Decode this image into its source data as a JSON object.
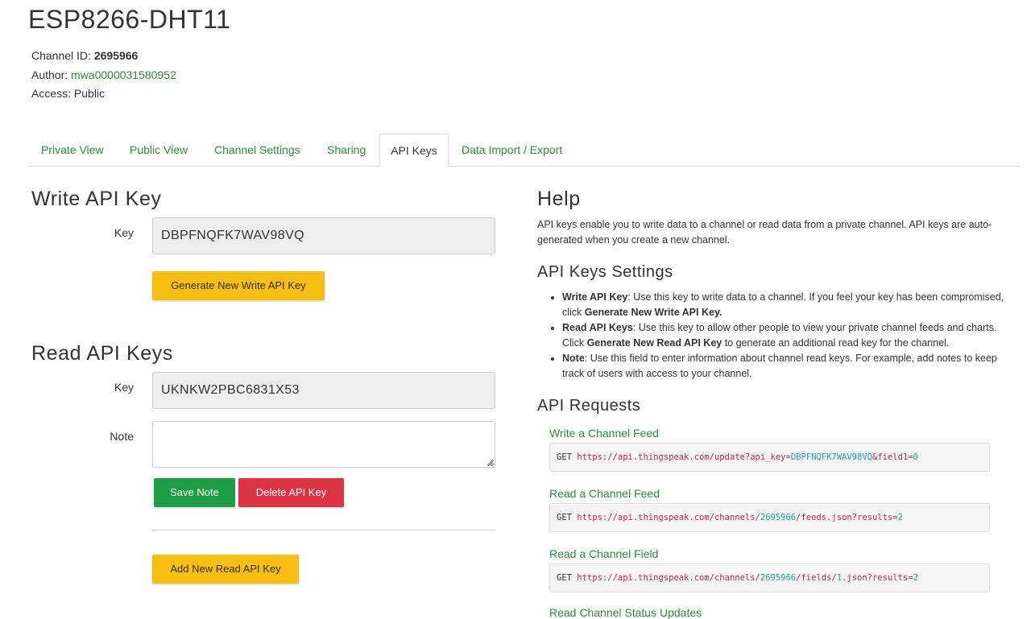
{
  "channel": {
    "title": "ESP8266-DHT11",
    "id_label": "Channel ID:",
    "id_value": "2695966",
    "author_label": "Author:",
    "author_value": "mwa0000031580952",
    "access_label": "Access:",
    "access_value": "Public"
  },
  "tabs": [
    {
      "label": "Private View"
    },
    {
      "label": "Public View"
    },
    {
      "label": "Channel Settings"
    },
    {
      "label": "Sharing"
    },
    {
      "label": "API Keys"
    },
    {
      "label": "Data Import / Export"
    }
  ],
  "active_tab": "API Keys",
  "write_key": {
    "heading": "Write API Key",
    "key_label": "Key",
    "key_value": "DBPFNQFK7WAV98VQ",
    "generate_label": "Generate New Write API Key"
  },
  "read_keys": {
    "heading": "Read API Keys",
    "key_label": "Key",
    "key_value": "UKNKW2PBC6831X53",
    "note_label": "Note",
    "note_value": "",
    "save_label": "Save Note",
    "delete_label": "Delete API Key",
    "add_label": "Add New Read API Key"
  },
  "help": {
    "heading": "Help",
    "paragraph": "API keys enable you to write data to a channel or read data from a private channel. API keys are auto-generated when you create a new channel.",
    "settings_heading": "API Keys Settings",
    "bullets": [
      {
        "term": "Write API Key",
        "pre": ": Use this key to write data to a channel. If you feel your key has been compromised, click ",
        "strong": "Generate New Write API Key.",
        "post": ""
      },
      {
        "term": "Read API Keys",
        "pre": ": Use this key to allow other people to view your private channel feeds and charts. Click ",
        "strong": "Generate New Read API Key",
        "post": " to generate an additional read key for the channel."
      },
      {
        "term": "Note",
        "pre": ": Use this field to enter information about channel read keys. For example, add notes to keep track of users with access to your channel.",
        "strong": "",
        "post": ""
      }
    ],
    "requests_heading": "API Requests",
    "requests": [
      {
        "title": "Write a Channel Feed",
        "method": "GET",
        "url_a": "https://api.thingspeak.com/update?api_key=",
        "val_a": "DBPFNQFK7WAV98VQ",
        "url_b": "&field1=",
        "val_b": "0"
      },
      {
        "title": "Read a Channel Feed",
        "method": "GET",
        "url_a": "https://api.thingspeak.com/channels/",
        "val_a": "2695966",
        "url_b": "/feeds.json?results=",
        "val_b": "2"
      },
      {
        "title": "Read a Channel Field",
        "method": "GET",
        "url_a": "https://api.thingspeak.com/channels/",
        "val_a": "2695966",
        "url_b": "/fields/",
        "val_b": "1",
        "url_c": ".json?results=",
        "val_c": "2"
      }
    ],
    "next_request_title": "Read Channel Status Updates"
  }
}
